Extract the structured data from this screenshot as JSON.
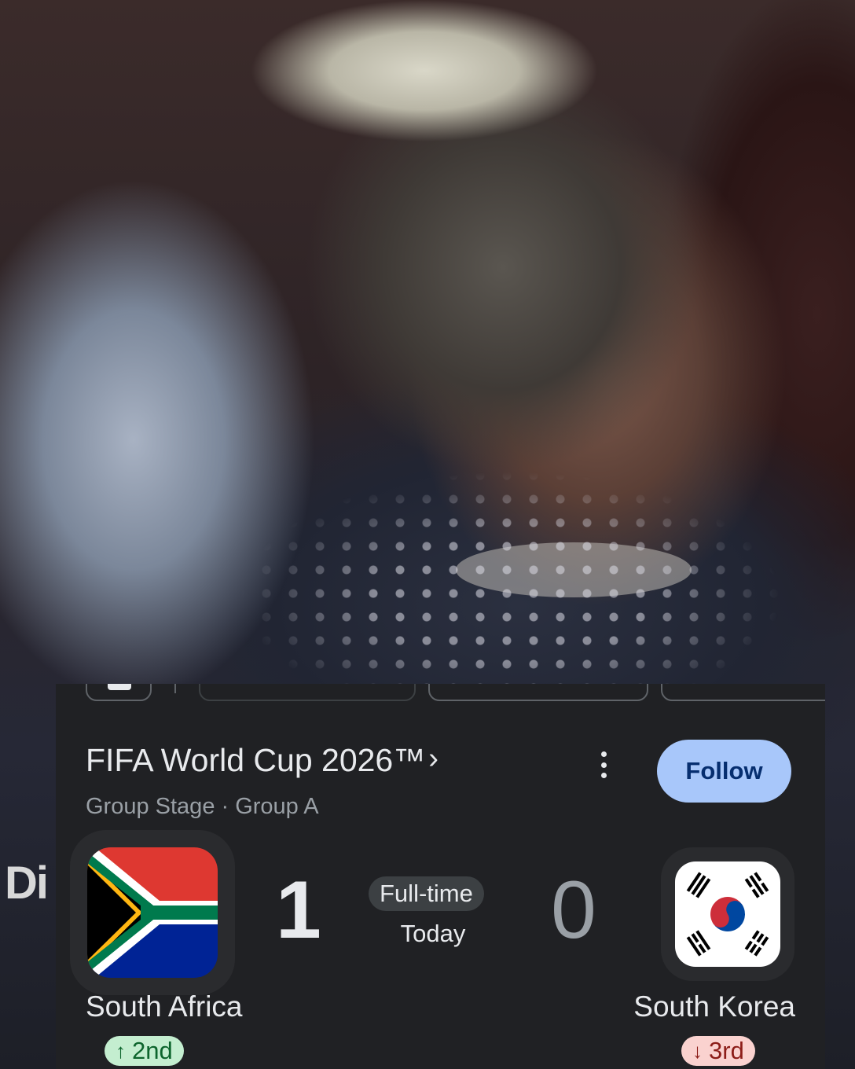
{
  "background": {
    "edge_text": "Di"
  },
  "card": {
    "title": "FIFA World Cup 2026™",
    "title_chevron": "›",
    "subtitle": "Group Stage · Group A",
    "follow_label": "Follow",
    "more_icon": "more-vert-icon"
  },
  "match": {
    "status": "Full-time",
    "date": "Today",
    "home": {
      "name": "South Africa",
      "score": "1",
      "rank": "2nd",
      "rank_arrow": "↑",
      "rank_color": "#c4eed0",
      "flag": "south-africa-flag"
    },
    "away": {
      "name": "South Korea",
      "score": "0",
      "rank": "3rd",
      "rank_arrow": "↓",
      "rank_color": "#fad2cf",
      "flag": "south-korea-flag"
    }
  },
  "colors": {
    "card_bg": "#202124",
    "follow_bg": "#a8c7fa",
    "follow_text": "#062e6f"
  }
}
